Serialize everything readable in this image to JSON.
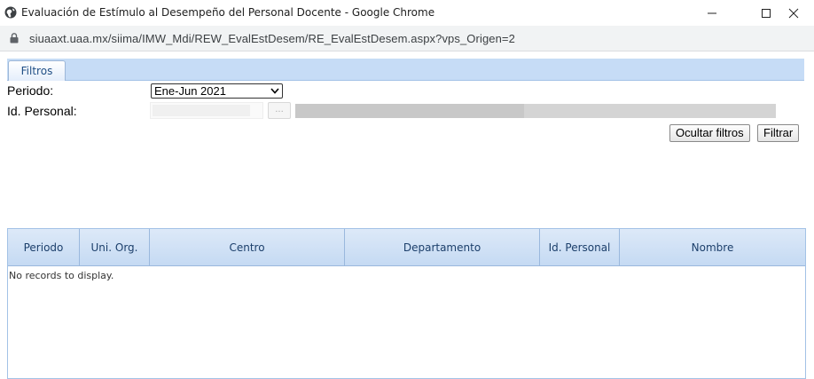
{
  "window": {
    "title": "Evaluación de Estímulo al Desempeño del Personal Docente - Google Chrome",
    "url": "siuaaxt.uaa.mx/siima/IMW_Mdi/REW_EvalEstDesem/RE_EvalEstDesem.aspx?vps_Origen=2"
  },
  "tabs": [
    {
      "label": "Filtros"
    }
  ],
  "filters": {
    "periodo_label": "Periodo:",
    "periodo_value": "Ene-Jun 2021",
    "id_personal_label": "Id. Personal:",
    "id_personal_value": "",
    "lookup_button": "..."
  },
  "actions": {
    "hide_filters": "Ocultar filtros",
    "filter": "Filtrar"
  },
  "grid": {
    "columns": [
      "Periodo",
      "Uni. Org.",
      "Centro",
      "Departamento",
      "Id. Personal",
      "Nombre"
    ],
    "empty_message": "No records to display."
  },
  "colors": {
    "tab_strip": "#c6dcf6",
    "grid_header": "#c5daf3",
    "grid_border": "#a3c2e6"
  },
  "icons": {
    "title_icon": "globe-icon",
    "address_icon": "lock-icon",
    "minimize": "minimize-icon",
    "maximize": "maximize-icon",
    "close": "close-icon"
  }
}
